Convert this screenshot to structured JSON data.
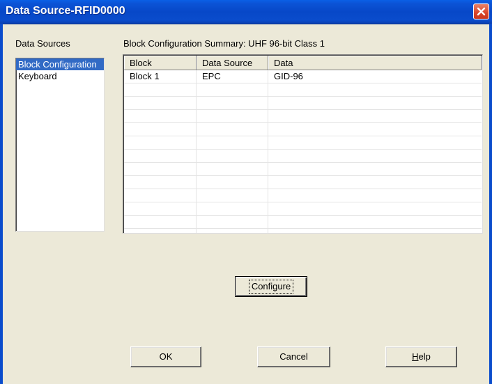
{
  "window": {
    "title": "Data Source-RFID0000",
    "close_icon": "close-icon"
  },
  "data_sources": {
    "label": "Data Sources",
    "items": [
      {
        "label": "Block Configuration",
        "selected": true
      },
      {
        "label": "Keyboard",
        "selected": false
      }
    ]
  },
  "summary": {
    "label": "Block Configuration Summary: UHF 96-bit Class 1"
  },
  "grid": {
    "columns": [
      "Block",
      "Data Source",
      "Data"
    ],
    "rows": [
      [
        "Block 1",
        "EPC",
        "GID-96"
      ]
    ]
  },
  "buttons": {
    "configure": "Configure",
    "ok": "OK",
    "cancel": "Cancel",
    "help_first": "H",
    "help_rest": "elp"
  },
  "colors": {
    "titlebar": "#0a4ccc",
    "selection": "#316ac5",
    "dialog_bg": "#ece9d8",
    "close": "#d9452a"
  }
}
